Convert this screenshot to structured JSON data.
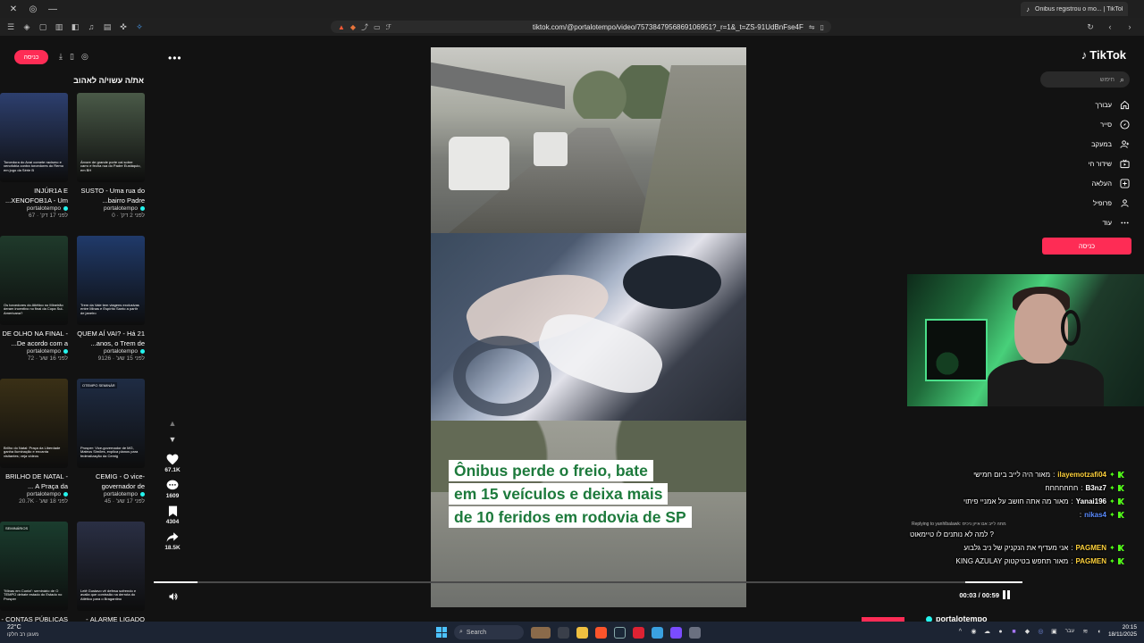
{
  "browser": {
    "active_tab_title": "Ônibus registrou o mo... | TikTok",
    "url": "tiktok.com/@portalotempo/video/7573847956869106951?_r=1&_t=ZS-91UdBnFse4F"
  },
  "left_panel": {
    "login_label": "כניסה",
    "section_title": "את/ה עשוי/ה לאהוב",
    "cards": [
      {
        "title": "INJÚR1A E XENOFOB1A - Um...",
        "author": "portalotempo",
        "meta": "לפני 17 דק' · 67",
        "thumb_tag": "",
        "caption": "Torcedora do Avaí comete racismo e xenofobia contra torcedores do Remo em jogo da Série B",
        "bg": "#2d3f6e"
      },
      {
        "title": "SUSTO - Uma rua do bairro Padre...",
        "author": "portalotempo",
        "meta": "לפני 2 דק' · 0",
        "thumb_tag": "",
        "caption": "Árvore de grande porte cai sobre carro e fecha rua do Padre Eustáquio, em BH",
        "bg": "#4a5a48"
      },
      {
        "title": "DE OLHO NA FINAL - De acordo com a...",
        "author": "portalotempo",
        "meta": "לפני 16 שע' · 72",
        "thumb_tag": "",
        "caption": "Os torcedores do Atlético no Mineirão deram incentivo no final da Copa Sul-Americana?",
        "bg": "#1f3a2b"
      },
      {
        "title": "QUEM AÍ VAI? - Há 21 anos, o Trem de...",
        "author": "portalotempo",
        "meta": "לפני 15 שע' · 9126",
        "thumb_tag": "",
        "caption": "Trem da Vale tem viagens exclusivas entre Minas e Espírito Santo a partir de janeiro",
        "bg": "#203a6a"
      },
      {
        "title": "BRILHO DE NATAL - A Praça da ...",
        "author": "portalotempo",
        "meta": "לפני 18 שע' · 20.7K",
        "thumb_tag": "",
        "caption": "Brilho do Natal: Praça da Liberdade ganha iluminação e encanta visitantes; veja vídeos",
        "bg": "#3a3016"
      },
      {
        "title": "CEMIG - O vice-governador de Minas...",
        "author": "portalotempo",
        "meta": "לפני 17 שע' · 45",
        "thumb_tag": "OTEMPO SEMINÁR",
        "caption": "Prosper: Vice-governador de MG, Mateus Simões, explica planos para federalização da Cemig",
        "bg": "#1f2c44"
      },
      {
        "title": "CONTAS PÚBLICAS -",
        "author": "",
        "meta": "",
        "thumb_tag": "SEMINÁRIOS",
        "caption": "\"Minas em Conta\": seminário de O TEMPO debate estado do Estado no Prosper",
        "bg": "#1a3d2e"
      },
      {
        "title": "ALARME LIGADO -",
        "author": "",
        "meta": "",
        "thumb_tag": "",
        "caption": "Lelê Gustavo vê defesa sofrendo e avalia que comissão na derrota do Atlético para o Bragantino",
        "bg": "#2a2f44"
      }
    ]
  },
  "video": {
    "headline_lines": [
      "Ônibus perde o freio, bate",
      "em 15 veículos e deixa mais",
      "de 10 feridos em rodovia de SP"
    ],
    "likes": "67.1K",
    "comments": "1609",
    "saves": "4304",
    "shares": "18.5K",
    "time": "00:03 / 00:59",
    "progress": 0.05,
    "author": "portalotempo"
  },
  "right_nav": {
    "logo": "TikTok",
    "search_placeholder": "חיפוש",
    "items": [
      {
        "label": "עבורך",
        "icon": "home-icon"
      },
      {
        "label": "סייר",
        "icon": "compass-icon"
      },
      {
        "label": "במעקב",
        "icon": "following-icon"
      },
      {
        "label": "שידור חי",
        "icon": "live-icon"
      },
      {
        "label": "העלאה",
        "icon": "upload-icon"
      },
      {
        "label": "פרופיל",
        "icon": "profile-icon"
      },
      {
        "label": "עוד",
        "icon": "more-icon"
      }
    ],
    "login_label": "כניסה"
  },
  "chat": {
    "lines": [
      {
        "user": "ilayemotzafi04",
        "msg": "מאור היה לייב ביום חמישי",
        "user_color": "#ffd23c"
      },
      {
        "user": "B3nz7",
        "msg": "חחחחחחח",
        "user_color": "#ffffff"
      },
      {
        "user": "Yanai196",
        "msg": "מאור מה אתה חושב על אמניי פיתוי",
        "user_color": "#ffffff"
      },
      {
        "user": "nikas4",
        "msg": "",
        "user_color": "#5b8cff"
      },
      {
        "user": "",
        "msg": "? למה לא נותנים לו טיימאוט",
        "user_color": "#ffffff",
        "reply": "Replying to yanhlbalawk: מתה לייב אם אייון ניכיס"
      },
      {
        "user": "PAGMEN",
        "msg": "אני מעדיף את הנקניק של ניב גלבוע",
        "user_color": "#ffd23c"
      },
      {
        "user": "PAGMEN",
        "msg": "מאור תחפש בטיקטוק KING AZULAY",
        "user_color": "#ffd23c"
      }
    ]
  },
  "taskbar": {
    "temp": "22°C",
    "weather_text": "מעונן רב חלקו",
    "search_label": "Search",
    "time": "20:15",
    "date": "18/11/2025",
    "lang": "עבר"
  }
}
